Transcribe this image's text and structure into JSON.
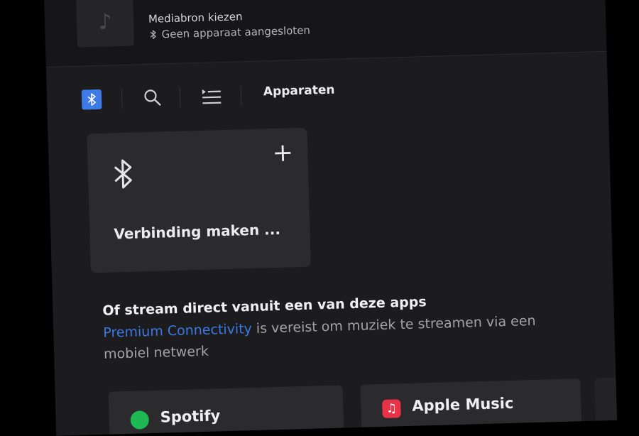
{
  "media_source": {
    "title": "Mediabron kiezen",
    "status": "Geen apparaat aangesloten",
    "art_icon": "music-note-icon"
  },
  "tabs": {
    "active_icon": "bluetooth-icon",
    "search_icon": "search-icon",
    "list_icon": "queue-list-icon",
    "title": "Apparaten"
  },
  "connect_card": {
    "icon": "bluetooth-icon",
    "add_icon": "plus-icon",
    "label": "Verbinding maken ..."
  },
  "stream": {
    "heading": "Of stream direct vanuit een van deze apps",
    "link_text": "Premium Connectivity",
    "note_rest": " is vereist om muziek te streamen via een mobiel netwerk"
  },
  "apps": [
    {
      "name": "Spotify",
      "icon": "spotify-icon",
      "color": "#1db954"
    },
    {
      "name": "Apple Music",
      "icon": "apple-music-icon",
      "color": "#e63348"
    }
  ],
  "colors": {
    "accent": "#3e7be6",
    "link": "#3d78e6",
    "background": "#1c1c1e",
    "card": "#2b2b2d"
  }
}
